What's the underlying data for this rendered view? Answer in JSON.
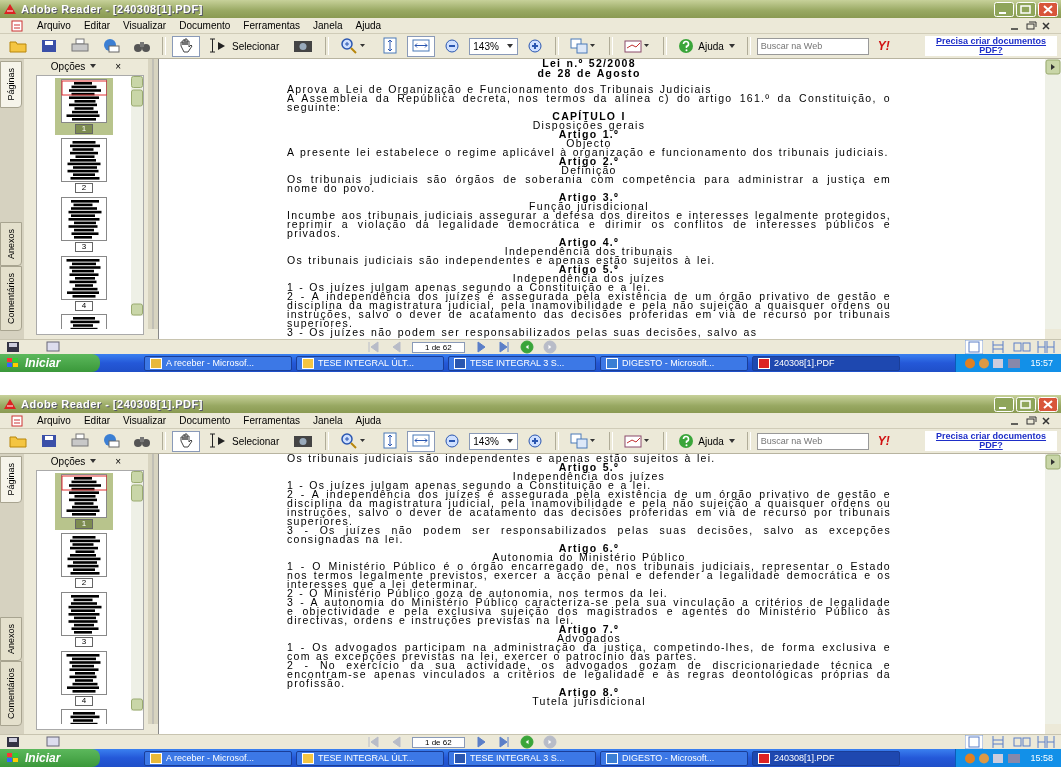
{
  "screens": [
    {
      "window": {
        "title": "Adobe Reader - [240308[1].PDF]"
      },
      "menu": [
        "Arquivo",
        "Editar",
        "Visualizar",
        "Documento",
        "Ferramentas",
        "Janela",
        "Ajuda"
      ],
      "tools": [
        {
          "kind": "open",
          "selected": false
        },
        {
          "kind": "save",
          "selected": false
        },
        {
          "kind": "print",
          "selected": false
        },
        {
          "kind": "email",
          "selected": false
        },
        {
          "kind": "find",
          "selected": false
        },
        {
          "kind": "hand",
          "selected": true
        },
        {
          "kind": "select",
          "label": "Selecionar",
          "selected": false
        },
        {
          "kind": "snapshot",
          "selected": false
        },
        {
          "kind": "zoom_menu",
          "selected": false
        },
        {
          "kind": "fit_page",
          "selected": false
        },
        {
          "kind": "fit_width",
          "selected": true
        },
        {
          "kind": "zoom_out",
          "selected": false
        },
        {
          "kind": "zoom_field",
          "value": "143%"
        },
        {
          "kind": "zoom_in",
          "selected": false
        },
        {
          "kind": "pages_menu",
          "selected": false
        },
        {
          "kind": "sign_menu",
          "selected": false
        },
        {
          "kind": "help",
          "label": "Ajuda",
          "selected": false
        },
        {
          "kind": "web_search",
          "placeholder": "Buscar na Web"
        },
        {
          "kind": "logo",
          "label": "Y!"
        }
      ],
      "promo_link": "Precisa criar documentos PDF?",
      "side_tabs": [
        {
          "label": "Páginas",
          "selected": true
        },
        {
          "label": "Anexos",
          "selected": false
        },
        {
          "label": "Comentários",
          "selected": false
        }
      ],
      "panel": {
        "options": "Opções",
        "close": "×"
      },
      "thumbnails": [
        {
          "label": "1",
          "selected": true
        },
        {
          "label": "2",
          "selected": false
        },
        {
          "label": "3",
          "selected": false
        },
        {
          "label": "4",
          "selected": false
        },
        {
          "selected": false
        }
      ],
      "document": [
        {
          "kind": "title",
          "text": "Lei n.º 52/2008"
        },
        {
          "kind": "title",
          "text": "de 28 de Agosto"
        },
        {
          "kind": "paragraph",
          "text": "Aprova a Lei de Organização e Funcionamento dos Tribunais Judiciais"
        },
        {
          "kind": "paragraph",
          "text": "A Assembleia da República decreta, nos termos da alínea c) do artigo 161.º da Constituição, o seguinte:"
        },
        {
          "kind": "heading",
          "text": "CAPÍTULO I"
        },
        {
          "kind": "subtitle",
          "text": "Disposições gerais"
        },
        {
          "kind": "heading",
          "text": "Artigo 1.º"
        },
        {
          "kind": "subtitle",
          "text": "Objecto"
        },
        {
          "kind": "paragraph",
          "text": "A presente lei estabelece o regime aplicável à organização e funcionamento dos tribunais judiciais."
        },
        {
          "kind": "heading",
          "text": "Artigo 2.º"
        },
        {
          "kind": "subtitle",
          "text": "Definição"
        },
        {
          "kind": "paragraph",
          "text": "Os tribunais judiciais são órgãos de soberania com competência para administrar a justiça em nome do povo."
        },
        {
          "kind": "heading",
          "text": "Artigo 3.º"
        },
        {
          "kind": "subtitle",
          "text": "Função jurisdicional"
        },
        {
          "kind": "paragraph",
          "text": "Incumbe aos tribunais judiciais assegurar a defesa dos direitos e interesses legalmente protegidos, reprimir a violação da legalidade democrática e dirimir os conflitos de interesses públicos e privados."
        },
        {
          "kind": "heading",
          "text": "Artigo 4.º"
        },
        {
          "kind": "subtitle",
          "text": "Independência dos tribunais"
        },
        {
          "kind": "paragraph",
          "text": "Os tribunais judiciais são independentes e apenas estão sujeitos à lei."
        },
        {
          "kind": "heading",
          "text": "Artigo 5.º"
        },
        {
          "kind": "subtitle",
          "text": "Independência dos juízes"
        },
        {
          "kind": "paragraph",
          "text": "1 - Os juízes julgam apenas segundo a Constituição e a lei."
        },
        {
          "kind": "paragraph",
          "text": "2 - A independência dos juízes é assegurada pela existência de um órgão privativo de gestão e disciplina da magistratura judicial, pela inamovibilidade e pela não sujeição a quaisquer ordens ou instruções, salvo o dever de acatamento das decisões proferidas em via de recurso por tribunais superiores."
        },
        {
          "kind": "paragraph",
          "text": "3 - Os juízes não podem ser responsabilizados pelas suas decisões, salvo as"
        }
      ],
      "nav": [
        {
          "kind": "first",
          "disabled": true
        },
        {
          "kind": "prev",
          "disabled": true
        },
        {
          "kind": "page_field",
          "value": "1 de 62"
        },
        {
          "kind": "next",
          "disabled": false
        },
        {
          "kind": "last",
          "disabled": false
        },
        {
          "kind": "back",
          "disabled": false
        },
        {
          "kind": "forward",
          "disabled": true
        }
      ],
      "views": [
        {
          "kind": "single",
          "selected": true
        },
        {
          "kind": "continuous",
          "selected": false
        },
        {
          "kind": "facing",
          "selected": false
        },
        {
          "kind": "continuous_facing",
          "selected": false
        }
      ],
      "taskbar": {
        "start": "Iniciar",
        "tasks": [
          {
            "label": "A receber - Microsof...",
            "selected": false
          },
          {
            "label": "TESE INTEGRAL ÚLT...",
            "selected": false
          },
          {
            "label": "TESE INTEGRAL 3 S...",
            "selected": false
          },
          {
            "label": "DIGESTO - Microsoft...",
            "selected": false
          },
          {
            "label": "240308[1].PDF",
            "selected": true
          }
        ],
        "clock": "15:57"
      }
    },
    {
      "window": {
        "title": "Adobe Reader - [240308[1].PDF]"
      },
      "menu": [
        "Arquivo",
        "Editar",
        "Visualizar",
        "Documento",
        "Ferramentas",
        "Janela",
        "Ajuda"
      ],
      "tools": [
        {
          "kind": "open",
          "selected": false
        },
        {
          "kind": "save",
          "selected": false
        },
        {
          "kind": "print",
          "selected": false
        },
        {
          "kind": "email",
          "selected": false
        },
        {
          "kind": "find",
          "selected": false
        },
        {
          "kind": "hand",
          "selected": true
        },
        {
          "kind": "select",
          "label": "Selecionar",
          "selected": false
        },
        {
          "kind": "snapshot",
          "selected": false
        },
        {
          "kind": "zoom_menu",
          "selected": false
        },
        {
          "kind": "fit_page",
          "selected": false
        },
        {
          "kind": "fit_width",
          "selected": true
        },
        {
          "kind": "zoom_out",
          "selected": false
        },
        {
          "kind": "zoom_field",
          "value": "143%"
        },
        {
          "kind": "zoom_in",
          "selected": false
        },
        {
          "kind": "pages_menu",
          "selected": false
        },
        {
          "kind": "sign_menu",
          "selected": false
        },
        {
          "kind": "help",
          "label": "Ajuda",
          "selected": false
        },
        {
          "kind": "web_search",
          "placeholder": "Buscar na Web"
        },
        {
          "kind": "logo",
          "label": "Y!"
        }
      ],
      "promo_link": "Precisa criar documentos PDF?",
      "side_tabs": [
        {
          "label": "Páginas",
          "selected": true
        },
        {
          "label": "Anexos",
          "selected": false
        },
        {
          "label": "Comentários",
          "selected": false
        }
      ],
      "panel": {
        "options": "Opções",
        "close": "×"
      },
      "thumbnails": [
        {
          "label": "1",
          "selected": true
        },
        {
          "label": "2",
          "selected": false
        },
        {
          "label": "3",
          "selected": false
        },
        {
          "label": "4",
          "selected": false
        },
        {
          "selected": false
        }
      ],
      "document": [
        {
          "kind": "paragraph",
          "text": "Os tribunais judiciais são independentes e apenas estão sujeitos à lei."
        },
        {
          "kind": "heading",
          "text": "Artigo 5.º"
        },
        {
          "kind": "subtitle",
          "text": "Independência dos juízes"
        },
        {
          "kind": "paragraph",
          "text": "1 - Os juízes julgam apenas segundo a Constituição e a lei."
        },
        {
          "kind": "paragraph",
          "text": "2 - A independência dos juízes é assegurada pela existência de um órgão privativo de gestão e disciplina da magistratura judicial, pela inamovibilidade e pela não sujeição a quaisquer ordens ou instruções, salvo o dever de acatamento das decisões proferidas em via de recurso por tribunais superiores."
        },
        {
          "kind": "paragraph",
          "text": "3 - Os juízes não podem ser responsabilizados pelas suas decisões, salvo as excepções consignadas na lei."
        },
        {
          "kind": "heading",
          "text": "Artigo 6.º"
        },
        {
          "kind": "subtitle",
          "text": "Autonomia do Ministério Público"
        },
        {
          "kind": "paragraph",
          "text": "1 - O Ministério Público é o órgão encarregado de, nos tribunais judiciais, representar o Estado nos termos legalmente previstos, exercer a acção penal e defender a legalidade democrática e os interesses que a lei determinar."
        },
        {
          "kind": "paragraph",
          "text": "2 - O Ministério Público goza de autonomia, nos termos da lei."
        },
        {
          "kind": "paragraph",
          "text": "3 - A autonomia do Ministério Público caracteriza-se pela sua vinculação a critérios de legalidade e objectividade e pela exclusiva sujeição dos magistrados e agentes do Ministério Público às directivas, ordens e instruções previstas na lei."
        },
        {
          "kind": "heading",
          "text": "Artigo 7.º"
        },
        {
          "kind": "subtitle",
          "text": "Advogados"
        },
        {
          "kind": "paragraph",
          "text": "1 - Os advogados participam na administração da justiça, competindo-lhes, de forma exclusiva e com as excepções previstas na lei, exercer o patrocínio das partes."
        },
        {
          "kind": "paragraph",
          "text": "2 - No exercício da sua actividade, os advogados gozam de discricionariedade técnica e encontram-se apenas vinculados a critérios de legalidade e às regras deontológicas próprias da profissão."
        },
        {
          "kind": "heading",
          "text": "Artigo 8.º"
        },
        {
          "kind": "subtitle",
          "text": "Tutela jurisdicional"
        }
      ],
      "nav": [
        {
          "kind": "first",
          "disabled": true
        },
        {
          "kind": "prev",
          "disabled": true
        },
        {
          "kind": "page_field",
          "value": "1 de 62"
        },
        {
          "kind": "next",
          "disabled": false
        },
        {
          "kind": "last",
          "disabled": false
        },
        {
          "kind": "back",
          "disabled": false
        },
        {
          "kind": "forward",
          "disabled": true
        }
      ],
      "views": [
        {
          "kind": "single",
          "selected": true
        },
        {
          "kind": "continuous",
          "selected": false
        },
        {
          "kind": "facing",
          "selected": false
        },
        {
          "kind": "continuous_facing",
          "selected": false
        }
      ],
      "taskbar": {
        "start": "Iniciar",
        "tasks": [
          {
            "label": "A receber - Microsof...",
            "selected": false
          },
          {
            "label": "TESE INTEGRAL ÚLT...",
            "selected": false
          },
          {
            "label": "TESE INTEGRAL 3 S...",
            "selected": false
          },
          {
            "label": "DIGESTO - Microsoft...",
            "selected": false
          },
          {
            "label": "240308[1].PDF",
            "selected": true
          }
        ],
        "clock": "15:58"
      }
    }
  ]
}
